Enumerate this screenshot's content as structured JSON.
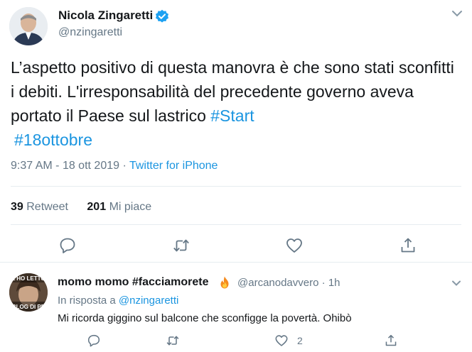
{
  "tweet": {
    "author_name": "Nicola Zingaretti",
    "author_handle": "@nzingaretti",
    "text_plain": "L’aspetto positivo di questa manovra è che sono stati sconfitti i debiti. L'irresponsabilità del precedente governo aveva portato il Paese sul lastrico ",
    "hashtag_1": "#Start",
    "hashtag_2": "#18ottobre",
    "time": "9:37 AM",
    "date": "18 ott 2019",
    "separator": "·",
    "source": "Twitter for iPhone",
    "retweets_count": "39",
    "retweets_label": "Retweet",
    "likes_count": "201",
    "likes_label": "Mi piace"
  },
  "reply": {
    "author_name": "momo momo #facciamorete",
    "author_handle": "@arcanodavvero",
    "separator": "·",
    "age": "1h",
    "in_reply_prefix": "In risposta a",
    "in_reply_mention": "@nzingaretti",
    "text": "Mi ricorda giggino sul balcone che sconfigge la povertà. Ohibò",
    "likes_count": "2",
    "avatar_caption_1": "L'HO LETTO",
    "avatar_caption_2": "BLOG DI PE"
  },
  "icons": {
    "verified": "verified-badge-icon",
    "more": "chevron-down-icon",
    "reply": "reply-icon",
    "retweet": "retweet-icon",
    "like": "heart-icon",
    "share": "share-icon",
    "fire": "fire-emoji-icon"
  },
  "colors": {
    "accent": "#1b95e0",
    "text": "#14171a",
    "secondary": "#657786",
    "divider": "#e6ecf0"
  }
}
